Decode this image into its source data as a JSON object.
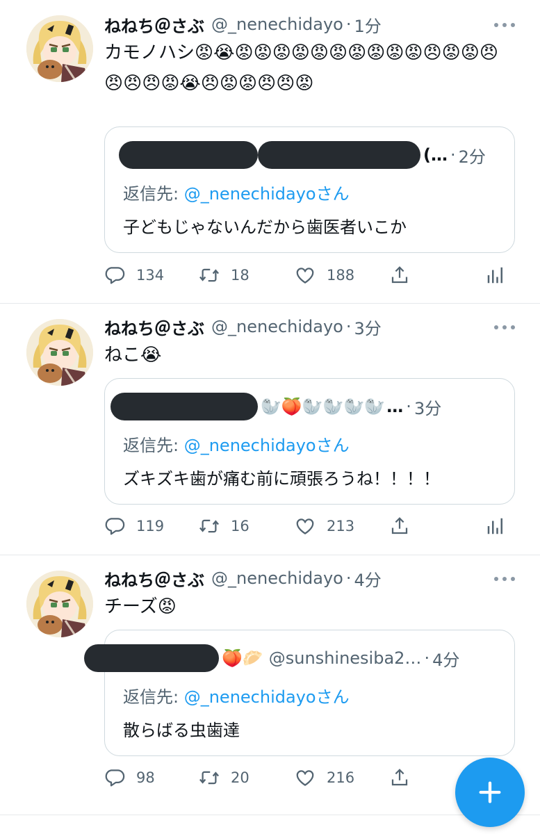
{
  "tweets": [
    {
      "name": "ねねち＠さぶ",
      "handle": "@_nenechidayo",
      "time": "1分",
      "text": "カモノハシ😡😭😡😡😡😡😡😡😡😡😡😡😠😡😡😠😠😠😠😡😭😠😡😡😠😠😡",
      "quote": {
        "tail": "(…",
        "time": "2分",
        "reply_prefix": "返信先: ",
        "reply_mention": "@_nenechidayo",
        "reply_suffix": "さん",
        "text": "子どもじゃないんだから歯医者いこか"
      },
      "stats": {
        "replies": "134",
        "retweets": "18",
        "likes": "188"
      }
    },
    {
      "name": "ねねち＠さぶ",
      "handle": "@_nenechidayo",
      "time": "3分",
      "text": "ねこ😭",
      "quote": {
        "emojis": "🦭🍑🦭🦭🦭🦭",
        "tail": "…",
        "time": "3分",
        "reply_prefix": "返信先: ",
        "reply_mention": "@_nenechidayo",
        "reply_suffix": "さん",
        "text": "ズキズキ歯が痛む前に頑張ろうね！！！！"
      },
      "stats": {
        "replies": "119",
        "retweets": "16",
        "likes": "213"
      }
    },
    {
      "name": "ねねち＠さぶ",
      "handle": "@_nenechidayo",
      "time": "4分",
      "text": "チーズ😡",
      "quote": {
        "emojis": "🍑🥟",
        "handle": "@sunshinesiba2…",
        "time": "4分",
        "reply_prefix": "返信先: ",
        "reply_mention": "@_nenechidayo",
        "reply_suffix": "さん",
        "text": "散らばる虫歯達"
      },
      "stats": {
        "replies": "98",
        "retweets": "20",
        "likes": "216"
      }
    }
  ],
  "sep": "·",
  "icons": {
    "reply": "reply-icon",
    "retweet": "retweet-icon",
    "like": "heart-icon",
    "share": "share-icon",
    "analytics": "analytics-icon",
    "compose": "plus-icon"
  },
  "colors": {
    "accent": "#1d9bf0",
    "muted": "#536471",
    "text": "#0f1419"
  }
}
